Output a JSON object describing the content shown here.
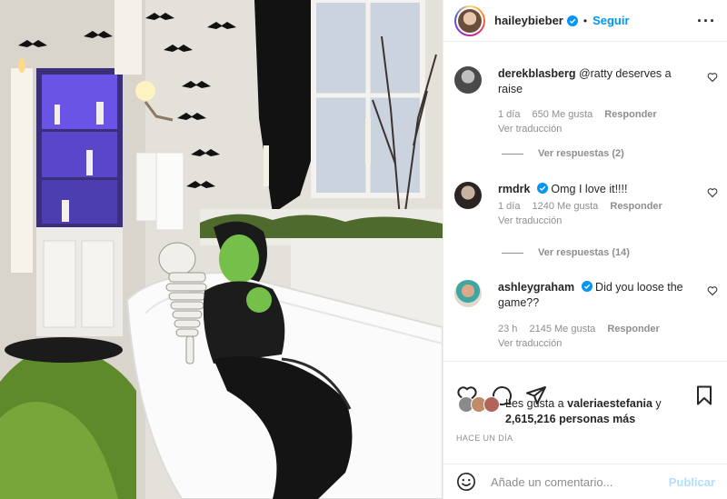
{
  "post": {
    "author": "haileybieber",
    "follow_label": "Seguir",
    "more_icon": "more-options-icon",
    "verified_color": "#0095f6"
  },
  "comments": [
    {
      "user": "derekblasberg",
      "verified": false,
      "text": "@ratty deserves a raise",
      "time": "1 día",
      "likes": "650 Me gusta",
      "reply": "Responder",
      "translate": "Ver traducción",
      "view_replies": "Ver respuestas (2)"
    },
    {
      "user": "rmdrk",
      "verified": true,
      "text": "Omg I love it!!!!",
      "time": "1 día",
      "likes": "1240 Me gusta",
      "reply": "Responder",
      "translate": "Ver traducción",
      "view_replies": "Ver respuestas (14)"
    },
    {
      "user": "ashleygraham",
      "verified": true,
      "text": "Did you loose the game??",
      "time": "23 h",
      "likes": "2145 Me gusta",
      "reply": "Responder",
      "translate": "Ver traducción"
    }
  ],
  "likes": {
    "prefix": "Les gusta a",
    "user": "valeriaestefania",
    "connector": "y",
    "count": "2,615,216 personas más"
  },
  "timestamp": "HACE UN DÍA",
  "add_comment": {
    "placeholder": "Añade un comentario...",
    "publish_label": "Publicar"
  },
  "colors": {
    "accent": "#0095f6",
    "publish_disabled": "#b2dffc",
    "muted": "#8e8e8e"
  }
}
